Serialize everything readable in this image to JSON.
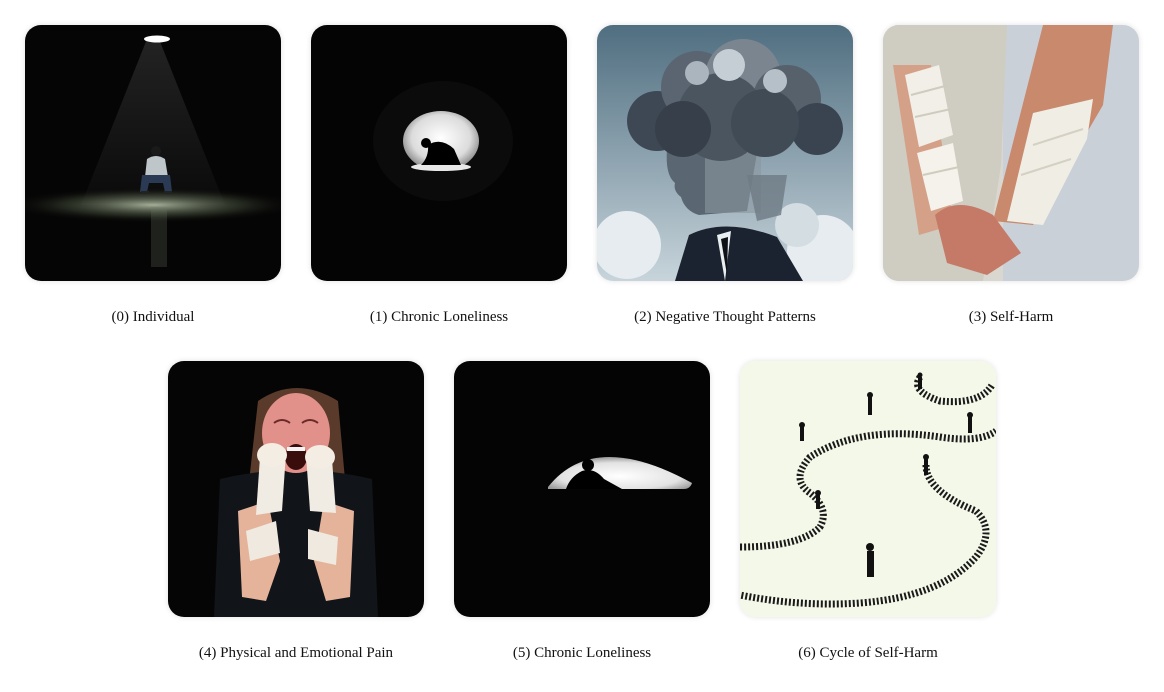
{
  "panels": [
    {
      "index": "(0)",
      "label": "Individual",
      "caption": "(0) Individual",
      "image": "person-sitting-alone-under-spotlight"
    },
    {
      "index": "(1)",
      "label": "Chronic Loneliness",
      "caption": "(1) Chronic Loneliness",
      "image": "silhouette-in-lit-tunnel"
    },
    {
      "index": "(2)",
      "label": "Negative Thought Patterns",
      "caption": "(2) Negative Thought Patterns",
      "image": "man-with-storm-cloud-head"
    },
    {
      "index": "(3)",
      "label": "Self-Harm",
      "caption": "(3) Self-Harm",
      "image": "bandaged-arms"
    },
    {
      "index": "(4)",
      "label": "Physical and Emotional Pain",
      "caption": "(4) Physical and Emotional Pain",
      "image": "screaming-woman-bandaged-arms"
    },
    {
      "index": "(5)",
      "label": "Chronic Loneliness",
      "caption": "(5) Chronic Loneliness",
      "image": "silhouette-in-dark-opening"
    },
    {
      "index": "(6)",
      "label": "Cycle of Self-Harm",
      "caption": "(6) Cycle of Self-Harm",
      "image": "figures-on-winding-fence-path"
    }
  ],
  "colors": {
    "background": "#ffffff",
    "caption_text": "#111111",
    "dark_scene": "#050505",
    "cycle_background": "#f4f8e8"
  }
}
